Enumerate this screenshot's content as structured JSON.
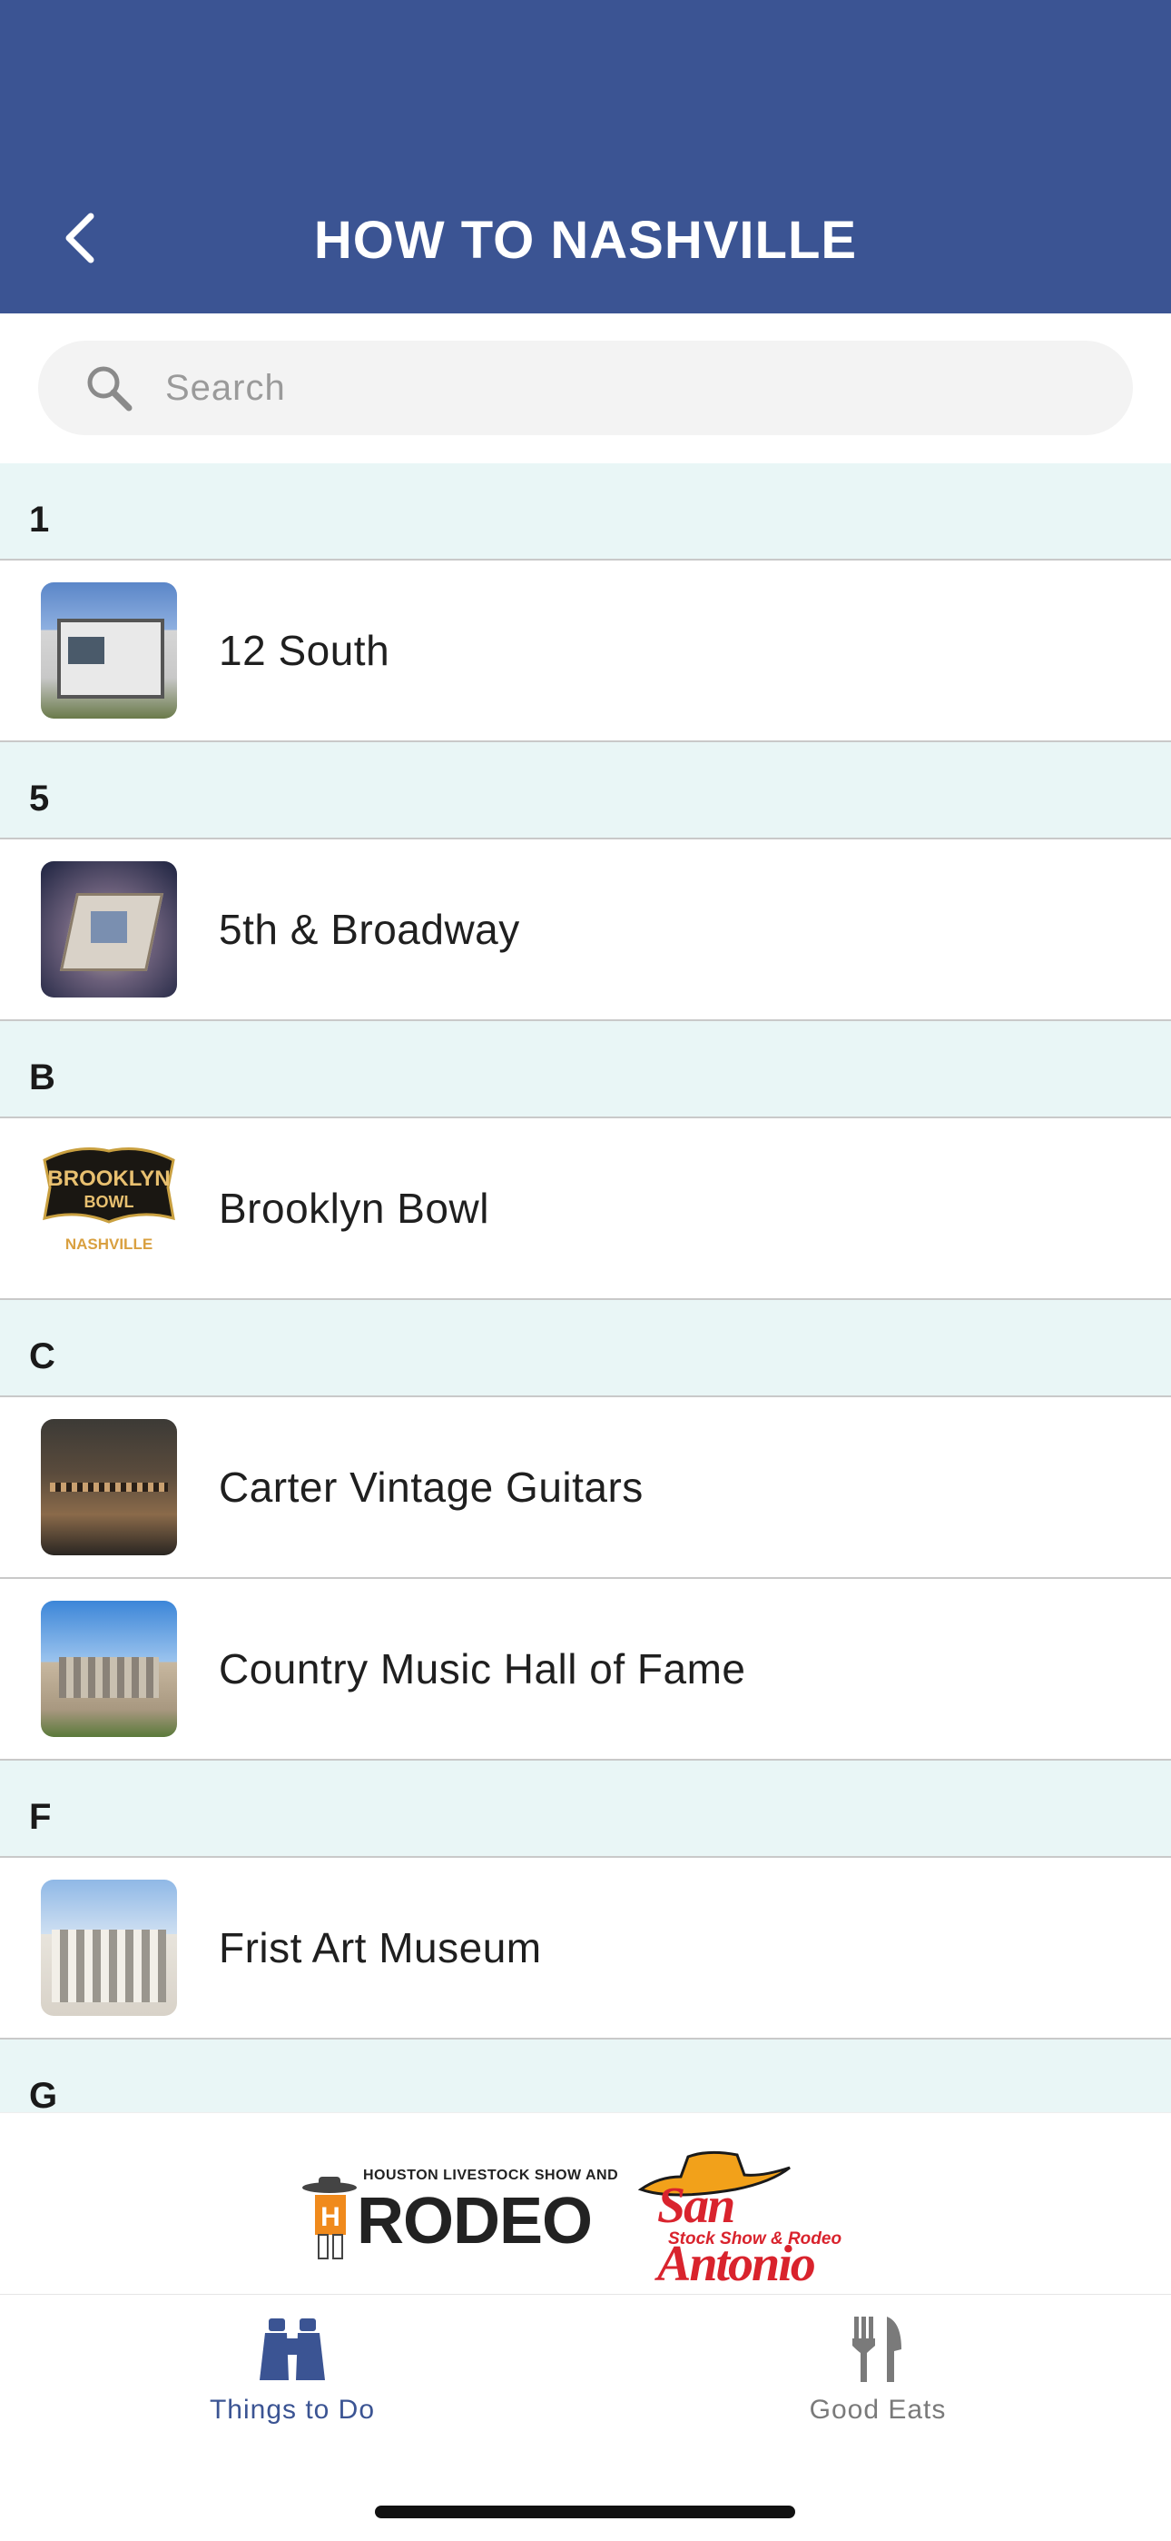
{
  "header": {
    "title": "HOW TO NASHVILLE",
    "back_icon": "chevron-left-icon",
    "background_color": "#3b5493"
  },
  "search": {
    "placeholder": "Search",
    "value": "",
    "icon": "search-icon"
  },
  "sections": [
    {
      "letter": "1",
      "items": [
        {
          "label": "12 South"
        }
      ]
    },
    {
      "letter": "5",
      "items": [
        {
          "label": "5th & Broadway"
        }
      ]
    },
    {
      "letter": "B",
      "items": [
        {
          "label": "Brooklyn Bowl"
        }
      ]
    },
    {
      "letter": "C",
      "items": [
        {
          "label": "Carter Vintage Guitars"
        },
        {
          "label": "Country Music Hall of Fame"
        }
      ]
    },
    {
      "letter": "F",
      "items": [
        {
          "label": "Frist Art Museum"
        }
      ]
    },
    {
      "letter": "G",
      "items": []
    }
  ],
  "brooklyn_logo": {
    "line1": "BROOKLYN",
    "line2": "BOWL",
    "line3": "NASHVILLE"
  },
  "banner": {
    "rodeo_small": "HOUSTON LIVESTOCK SHOW AND",
    "rodeo_big": "RODEO",
    "sa_name": "San Antonio",
    "sa_sub": "Stock Show & Rodeo"
  },
  "tabs": [
    {
      "label": "Things to Do",
      "icon": "binoculars-icon",
      "active": true,
      "color": "#3b5493"
    },
    {
      "label": "Good Eats",
      "icon": "fork-knife-icon",
      "active": false,
      "color": "#7a7a7a"
    }
  ],
  "colors": {
    "section_bg": "#e9f6f6",
    "divider": "#c9c9c9",
    "active_tab": "#3b5493",
    "inactive_tab": "#7a7a7a"
  }
}
